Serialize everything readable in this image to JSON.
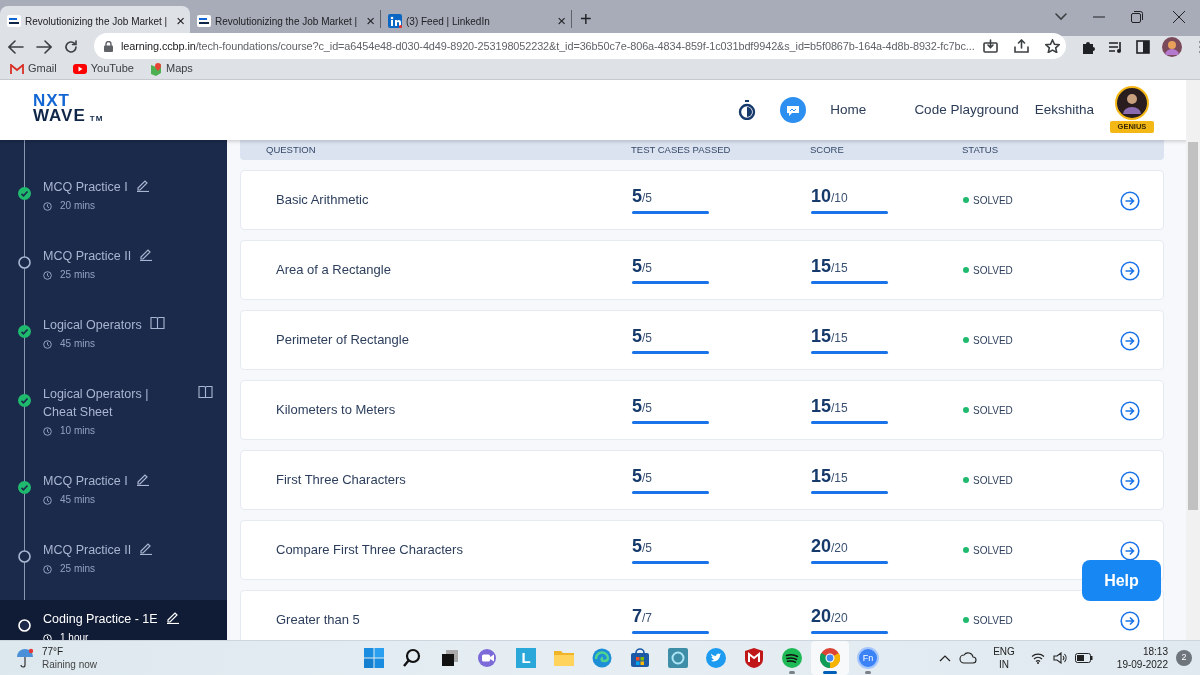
{
  "browser": {
    "tabs": [
      {
        "title": "Revolutionizing the Job Market |",
        "close": "×",
        "kind": "nxt",
        "selected": true
      },
      {
        "title": "Revolutionizing the Job Market |",
        "close": "×",
        "kind": "nxt",
        "selected": false
      },
      {
        "title": "(3) Feed | LinkedIn",
        "close": "×",
        "kind": "social",
        "selected": false
      }
    ],
    "new_tab": "+",
    "url_host": "learning.ccbp.in",
    "url_path": "/tech-foundations/course?c_id=a6454e48-d030-4d49-8920-253198052232&t_id=36b50c7e-806a-4834-859f-1c031bdf9942&s_id=b5f0867b-164a-4d8b-8932-fc7bc...",
    "bookmarks": [
      {
        "label": "Gmail",
        "kind": "mail"
      },
      {
        "label": "YouTube",
        "kind": "video"
      },
      {
        "label": "Maps",
        "kind": "map"
      }
    ]
  },
  "header": {
    "logo_top": "NXT",
    "logo_bottom": "WAVE",
    "logo_tm": "TM",
    "nav": [
      "Home",
      "Code Playground"
    ],
    "user": "Eekshitha",
    "badge": "GENIUS"
  },
  "sidebar": {
    "items": [
      {
        "title": "MCQ Practice I",
        "duration": "20 mins",
        "done": true,
        "kind": "edit",
        "selected": false
      },
      {
        "title": "MCQ Practice II",
        "duration": "25 mins",
        "done": false,
        "kind": "edit",
        "selected": false
      },
      {
        "title": "Logical Operators",
        "duration": "45 mins",
        "done": true,
        "kind": "read",
        "selected": false
      },
      {
        "title": "Logical Operators | Cheat Sheet",
        "duration": "10 mins",
        "done": true,
        "kind": "read",
        "selected": false
      },
      {
        "title": "MCQ Practice I",
        "duration": "45 mins",
        "done": true,
        "kind": "edit",
        "selected": false
      },
      {
        "title": "MCQ Practice II",
        "duration": "25 mins",
        "done": false,
        "kind": "edit",
        "selected": false
      },
      {
        "title": "Coding Practice - 1E",
        "duration": "1 hour",
        "done": false,
        "kind": "edit",
        "selected": true
      }
    ]
  },
  "table": {
    "columns": [
      "QUESTION",
      "TEST CASES PASSED",
      "SCORE",
      "STATUS"
    ],
    "rows": [
      {
        "question": "Basic Arithmetic",
        "passed": {
          "value": "5",
          "total": "/5",
          "level": 1
        },
        "score": {
          "value": "10",
          "total": "/10",
          "level": 1
        },
        "status": "SOLVED"
      },
      {
        "question": "Area of a Rectangle",
        "passed": {
          "value": "5",
          "total": "/5",
          "level": 1
        },
        "score": {
          "value": "15",
          "total": "/15",
          "level": 1
        },
        "status": "SOLVED"
      },
      {
        "question": "Perimeter of Rectangle",
        "passed": {
          "value": "5",
          "total": "/5",
          "level": 1
        },
        "score": {
          "value": "15",
          "total": "/15",
          "level": 1
        },
        "status": "SOLVED"
      },
      {
        "question": "Kilometers to Meters",
        "passed": {
          "value": "5",
          "total": "/5",
          "level": 1
        },
        "score": {
          "value": "15",
          "total": "/15",
          "level": 1
        },
        "status": "SOLVED"
      },
      {
        "question": "First Three Characters",
        "passed": {
          "value": "5",
          "total": "/5",
          "level": 1
        },
        "score": {
          "value": "15",
          "total": "/15",
          "level": 1
        },
        "status": "SOLVED"
      },
      {
        "question": "Compare First Three Characters",
        "passed": {
          "value": "5",
          "total": "/5",
          "level": 1
        },
        "score": {
          "value": "20",
          "total": "/20",
          "level": 1
        },
        "status": "SOLVED"
      },
      {
        "question": "Greater than 5",
        "passed": {
          "value": "7",
          "total": "/7",
          "level": 1
        },
        "score": {
          "value": "20",
          "total": "/20",
          "level": 1
        },
        "status": "SOLVED"
      }
    ]
  },
  "help_button": "Help",
  "taskbar": {
    "weather": {
      "temp": "77°F",
      "desc": "Raining now"
    },
    "apps": [
      {
        "kind": "start",
        "running": false,
        "selected": false
      },
      {
        "kind": "search",
        "running": false,
        "selected": false
      },
      {
        "kind": "taskview",
        "running": false,
        "selected": false
      },
      {
        "kind": "meet",
        "running": false,
        "selected": false
      },
      {
        "kind": "tile",
        "label": "L",
        "running": false,
        "selected": false
      },
      {
        "kind": "folder",
        "running": false,
        "selected": false
      },
      {
        "kind": "edge",
        "running": false,
        "selected": false
      },
      {
        "kind": "store",
        "running": false,
        "selected": false
      },
      {
        "kind": "ring",
        "running": false,
        "selected": false
      },
      {
        "kind": "bird",
        "running": false,
        "selected": false
      },
      {
        "kind": "shield",
        "running": false,
        "selected": false
      },
      {
        "kind": "music",
        "running": true,
        "selected": false
      },
      {
        "kind": "chrome",
        "running": true,
        "selected": true
      },
      {
        "kind": "round",
        "label": "Fn",
        "running": true,
        "selected": false
      }
    ],
    "language": "ENG",
    "region": "IN",
    "time": "18:13",
    "date": "19-09-2022",
    "notifications": "2"
  }
}
